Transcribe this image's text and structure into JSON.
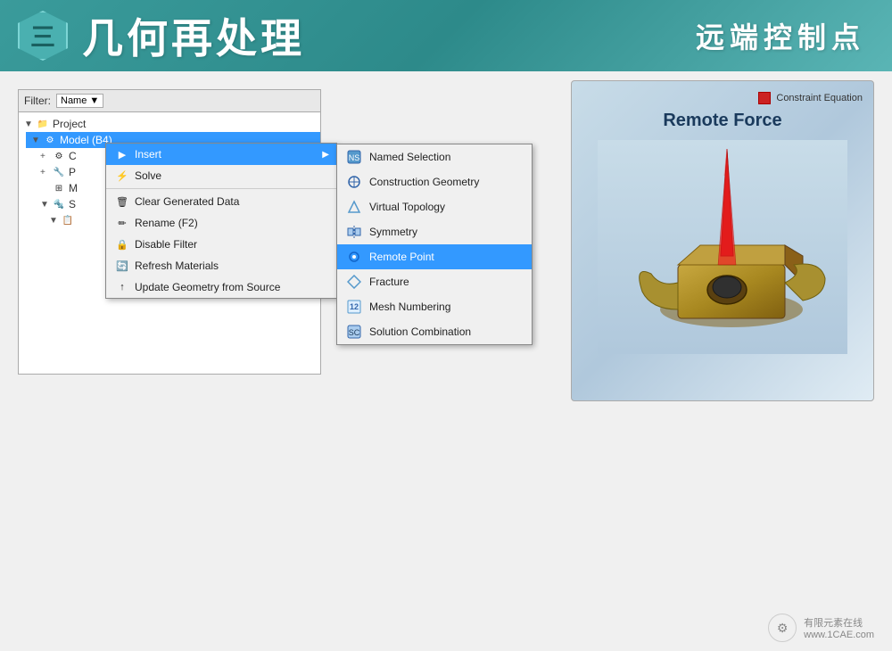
{
  "header": {
    "hexagon_char": "三",
    "title": "几何再处理",
    "subtitle": "远端控制点"
  },
  "filter": {
    "label": "Filter:",
    "value": "Name",
    "dropdown_arrow": "▼"
  },
  "tree": {
    "project_label": "Project",
    "items": [
      {
        "id": "project",
        "label": "Project",
        "indent": 0,
        "expand": "+"
      },
      {
        "id": "model",
        "label": "Model (B4)",
        "indent": 1,
        "selected": true
      },
      {
        "id": "c1",
        "label": "C",
        "indent": 2
      },
      {
        "id": "p1",
        "label": "P",
        "indent": 2
      },
      {
        "id": "m1",
        "label": "M",
        "indent": 2
      },
      {
        "id": "s1",
        "label": "S",
        "indent": 2
      },
      {
        "id": "sub1",
        "label": "",
        "indent": 3
      }
    ]
  },
  "context_menu": {
    "items": [
      {
        "id": "insert",
        "label": "Insert",
        "has_arrow": true,
        "active": true
      },
      {
        "id": "solve",
        "label": "Solve"
      },
      {
        "id": "clear",
        "label": "Clear Generated Data"
      },
      {
        "id": "rename",
        "label": "Rename (F2)"
      },
      {
        "id": "disable",
        "label": "Disable Filter"
      },
      {
        "id": "refresh",
        "label": "Refresh Materials"
      },
      {
        "id": "update",
        "label": "Update Geometry from Source"
      }
    ]
  },
  "submenu": {
    "items": [
      {
        "id": "named-selection",
        "label": "Named Selection",
        "icon": "⚙"
      },
      {
        "id": "construction-geometry",
        "label": "Construction Geometry",
        "icon": "📐"
      },
      {
        "id": "virtual-topology",
        "label": "Virtual Topology",
        "icon": "🔷"
      },
      {
        "id": "symmetry",
        "label": "Symmetry",
        "icon": "📊"
      },
      {
        "id": "remote-point",
        "label": "Remote Point",
        "icon": "🔵",
        "active": true
      },
      {
        "id": "fracture",
        "label": "Fracture",
        "icon": "⬡"
      },
      {
        "id": "mesh-numbering",
        "label": "Mesh Numbering",
        "icon": "🔢"
      },
      {
        "id": "solution-combination",
        "label": "Solution Combination",
        "icon": "⚙"
      }
    ]
  },
  "right_panel": {
    "legend_label": "Constraint Equation",
    "title": "Remote Force"
  },
  "footer": {
    "watermark_icon": "🔧",
    "text1": "有限元素在线",
    "text2": "www.1CAE.com"
  }
}
